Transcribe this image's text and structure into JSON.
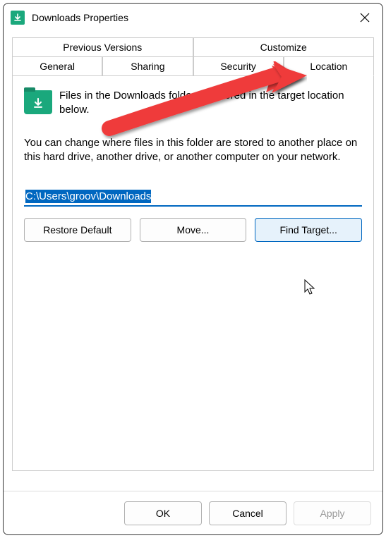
{
  "window": {
    "title": "Downloads Properties"
  },
  "tabs": {
    "top": [
      {
        "label": "Previous Versions"
      },
      {
        "label": "Customize"
      }
    ],
    "bottom": [
      {
        "label": "General"
      },
      {
        "label": "Sharing"
      },
      {
        "label": "Security"
      },
      {
        "label": "Location",
        "active": true
      }
    ]
  },
  "location_panel": {
    "info": "Files in the Downloads folder are stored in the target location below.",
    "description": "You can change where files in this folder are stored to another place on this hard drive, another drive, or another computer on your network.",
    "path_value": "C:\\Users\\groov\\Downloads",
    "buttons": {
      "restore": "Restore Default",
      "move": "Move...",
      "find_target": "Find Target..."
    }
  },
  "footer": {
    "ok": "OK",
    "cancel": "Cancel",
    "apply": "Apply"
  },
  "icons": {
    "app": "download-arrow",
    "folder": "download-folder",
    "close": "close"
  }
}
